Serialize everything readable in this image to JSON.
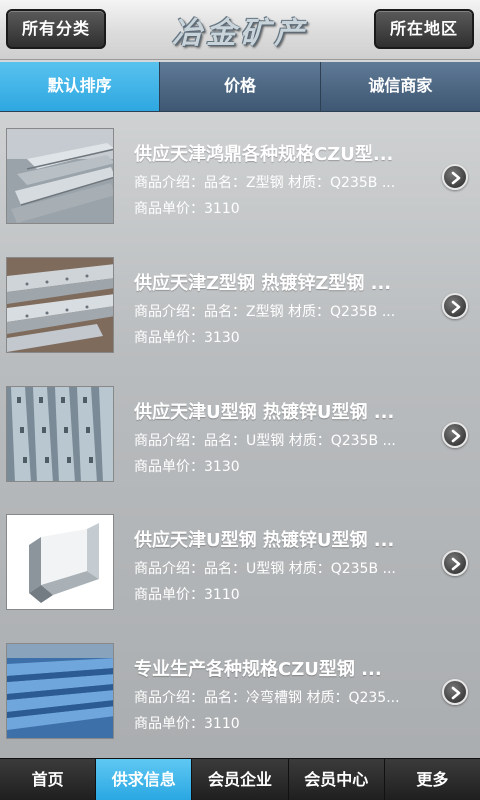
{
  "header": {
    "left_button": "所有分类",
    "title": "冶金矿产",
    "right_button": "所在地区"
  },
  "tabs": [
    {
      "label": "默认排序",
      "active": true
    },
    {
      "label": "价格",
      "active": false
    },
    {
      "label": "诚信商家",
      "active": false
    }
  ],
  "items": [
    {
      "title": "供应天津鸿鼎各种规格CZU型...",
      "desc": "商品介绍：品名：Z型钢 材质：Q235B ...",
      "price": "商品单价：3110",
      "thumb": "steel-z-rails-photo"
    },
    {
      "title": "供应天津Z型钢 热镀锌Z型钢 ...",
      "desc": "商品介绍：品名：Z型钢 材质：Q235B ...",
      "price": "商品单价：3130",
      "thumb": "galvanized-z-steel-photo"
    },
    {
      "title": "供应天津U型钢 热镀锌U型钢 ...",
      "desc": "商品介绍：品名：U型钢 材质：Q235B ...",
      "price": "商品单价：3130",
      "thumb": "perforated-u-steel-photo"
    },
    {
      "title": "供应天津U型钢 热镀锌U型钢 ...",
      "desc": "商品介绍：品名：U型钢 材质：Q235B ...",
      "price": "商品单价：3110",
      "thumb": "u-channel-photo"
    },
    {
      "title": "专业生产各种规格CZU型钢 ...",
      "desc": "商品介绍：品名：冷弯槽钢 材质：Q235...",
      "price": "商品单价：3110",
      "thumb": "blue-c-steel-stack-photo"
    }
  ],
  "bottom_nav": [
    {
      "label": "首页",
      "active": false
    },
    {
      "label": "供求信息",
      "active": true
    },
    {
      "label": "会员企业",
      "active": false
    },
    {
      "label": "会员中心",
      "active": false
    },
    {
      "label": "更多",
      "active": false
    }
  ],
  "colors": {
    "accent": "#2ea7e0",
    "tab_bar": "#4a647f",
    "bottom_bar": "#2a2a2a"
  }
}
